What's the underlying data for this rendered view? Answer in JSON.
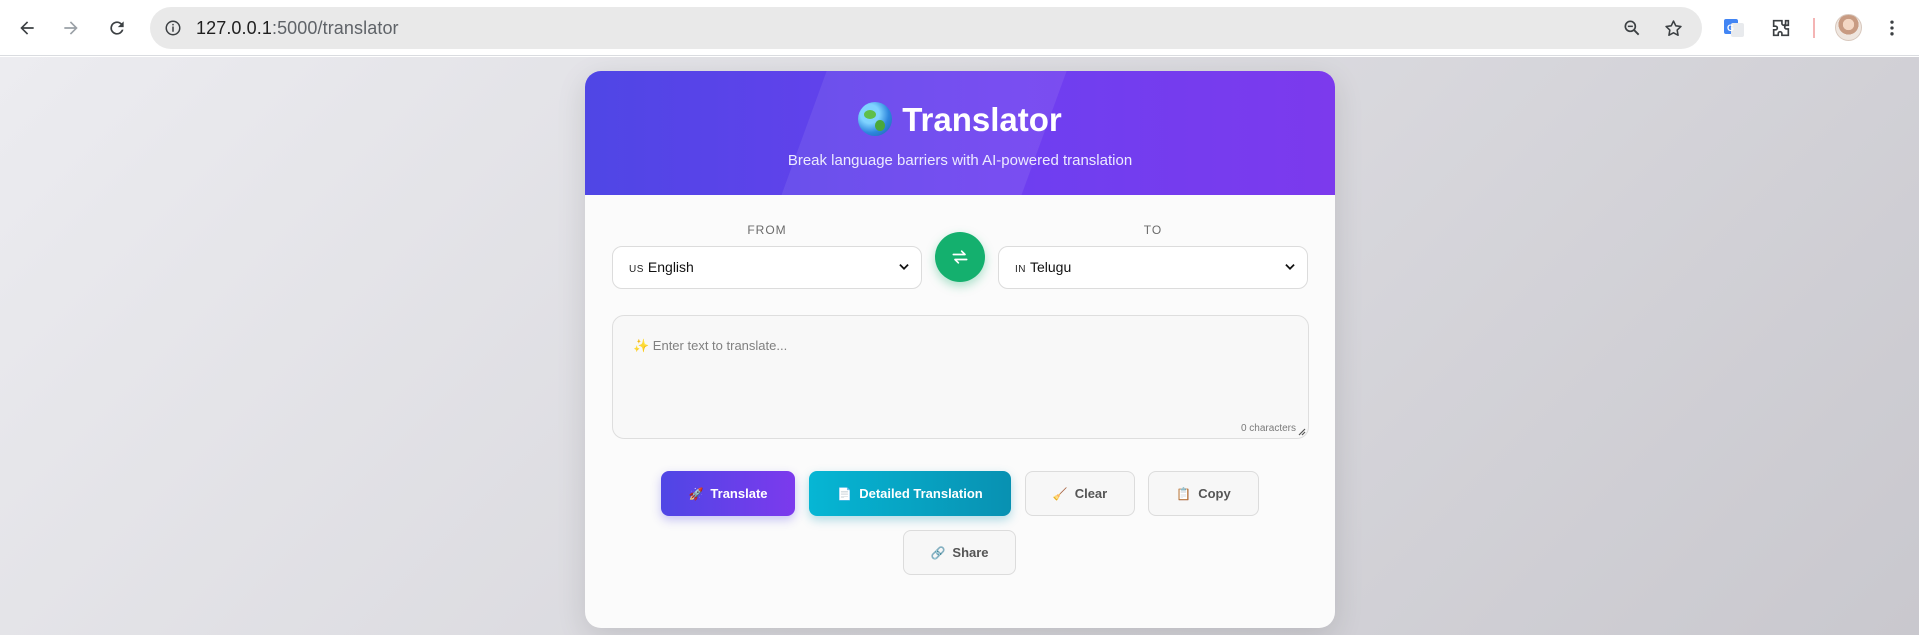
{
  "browser": {
    "url_host": "127.0.0.1",
    "url_path": ":5000/translator",
    "icons": [
      "back-icon",
      "forward-icon",
      "reload-icon",
      "site-info-icon",
      "zoom-icon",
      "bookmark-star-icon",
      "google-translate-icon",
      "extensions-icon",
      "profile-avatar",
      "menu-icon"
    ]
  },
  "header": {
    "title": "Translator",
    "subtitle": "Break language barriers with AI-powered translation"
  },
  "from": {
    "label": "FROM",
    "flag": "US",
    "language": "English"
  },
  "to": {
    "label": "TO",
    "flag": "IN",
    "language": "Telugu"
  },
  "input": {
    "placeholder": "✨ Enter text to translate...",
    "char_count": "0 characters"
  },
  "actions": {
    "translate": {
      "icon": "🚀",
      "label": "Translate"
    },
    "detailed": {
      "icon": "📄",
      "label": "Detailed Translation"
    },
    "clear": {
      "icon": "🧹",
      "label": "Clear"
    },
    "copy": {
      "icon": "📋",
      "label": "Copy"
    },
    "share": {
      "icon": "🔗",
      "label": "Share"
    }
  },
  "colors": {
    "header_start": "#4f46e5",
    "header_end": "#7c3aed",
    "swap": "#14b06e",
    "detailed": "#0891b2"
  }
}
